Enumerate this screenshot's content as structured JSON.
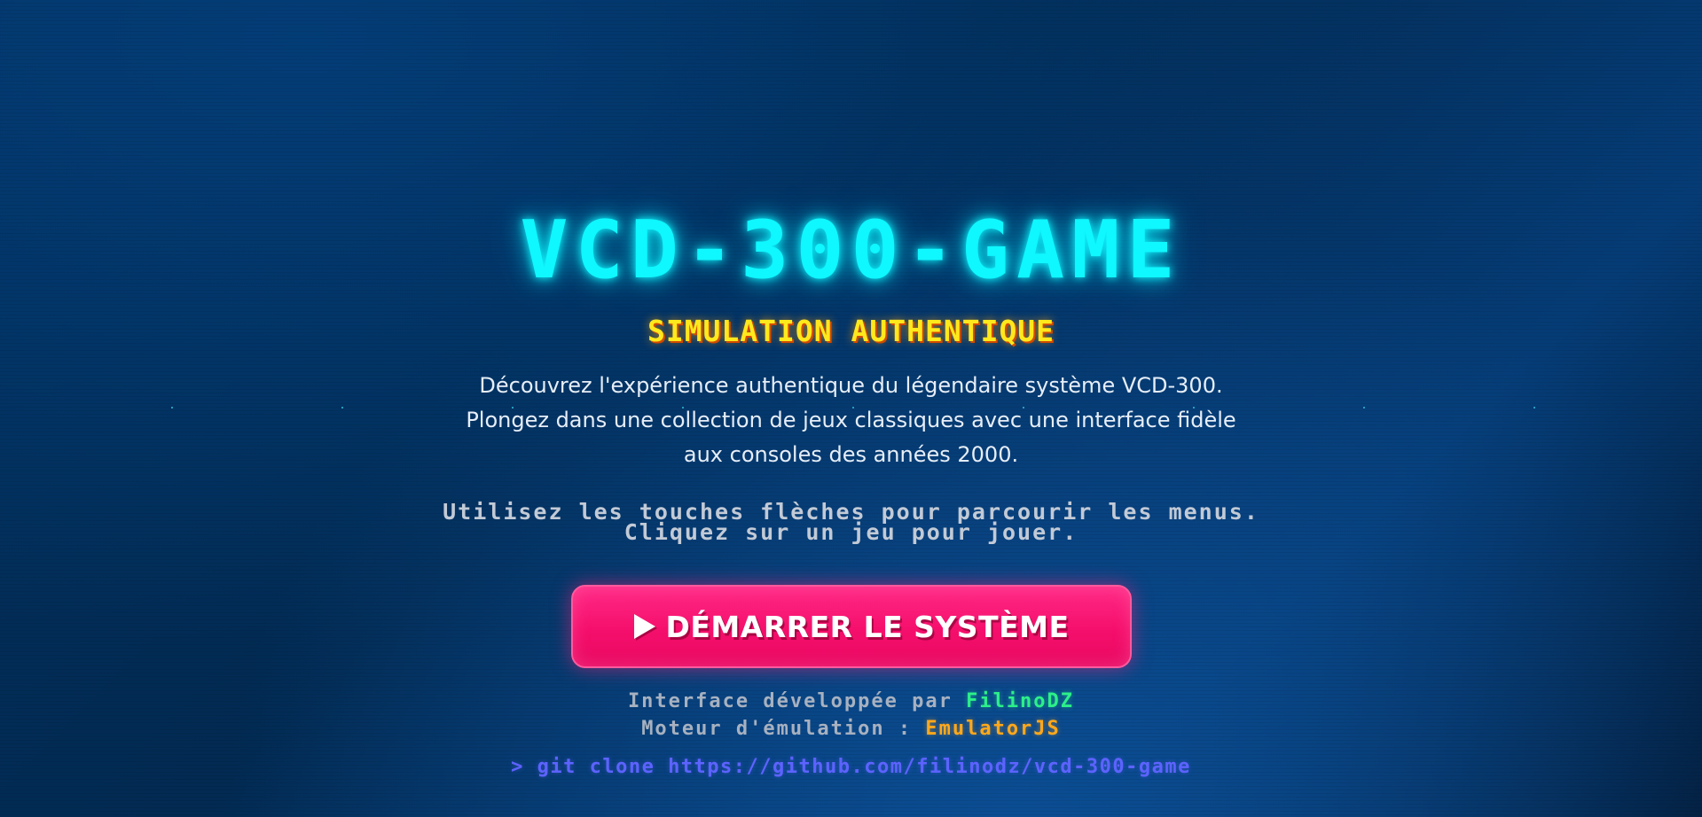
{
  "title": "VCD-300-GAME",
  "subtitle": "SIMULATION AUTHENTIQUE",
  "description": {
    "line1": "Découvrez l'expérience authentique du légendaire système VCD-300.",
    "line2": "Plongez dans une collection de jeux classiques avec une interface fidèle",
    "line3": "aux consoles des années 2000."
  },
  "instructions": {
    "line1": "Utilisez les touches flèches pour parcourir les menus.",
    "line2": "Cliquez sur un jeu pour jouer."
  },
  "start_button": {
    "icon": "play-icon",
    "label": "DÉMARRER LE SYSTÈME"
  },
  "credits": {
    "developer_prefix": "Interface développée par",
    "developer_name": "FilinoDZ",
    "engine_prefix": "Moteur d'émulation :",
    "engine_name": "EmulatorJS"
  },
  "git_command": "> git clone https://github.com/filinodz/vcd-300-game",
  "colors": {
    "title": "#0ff7ff",
    "subtitle": "#ffe81c",
    "button": "#f50f6c",
    "author": "#2cf089",
    "engine": "#ffa81c",
    "git": "#5d63ff"
  }
}
